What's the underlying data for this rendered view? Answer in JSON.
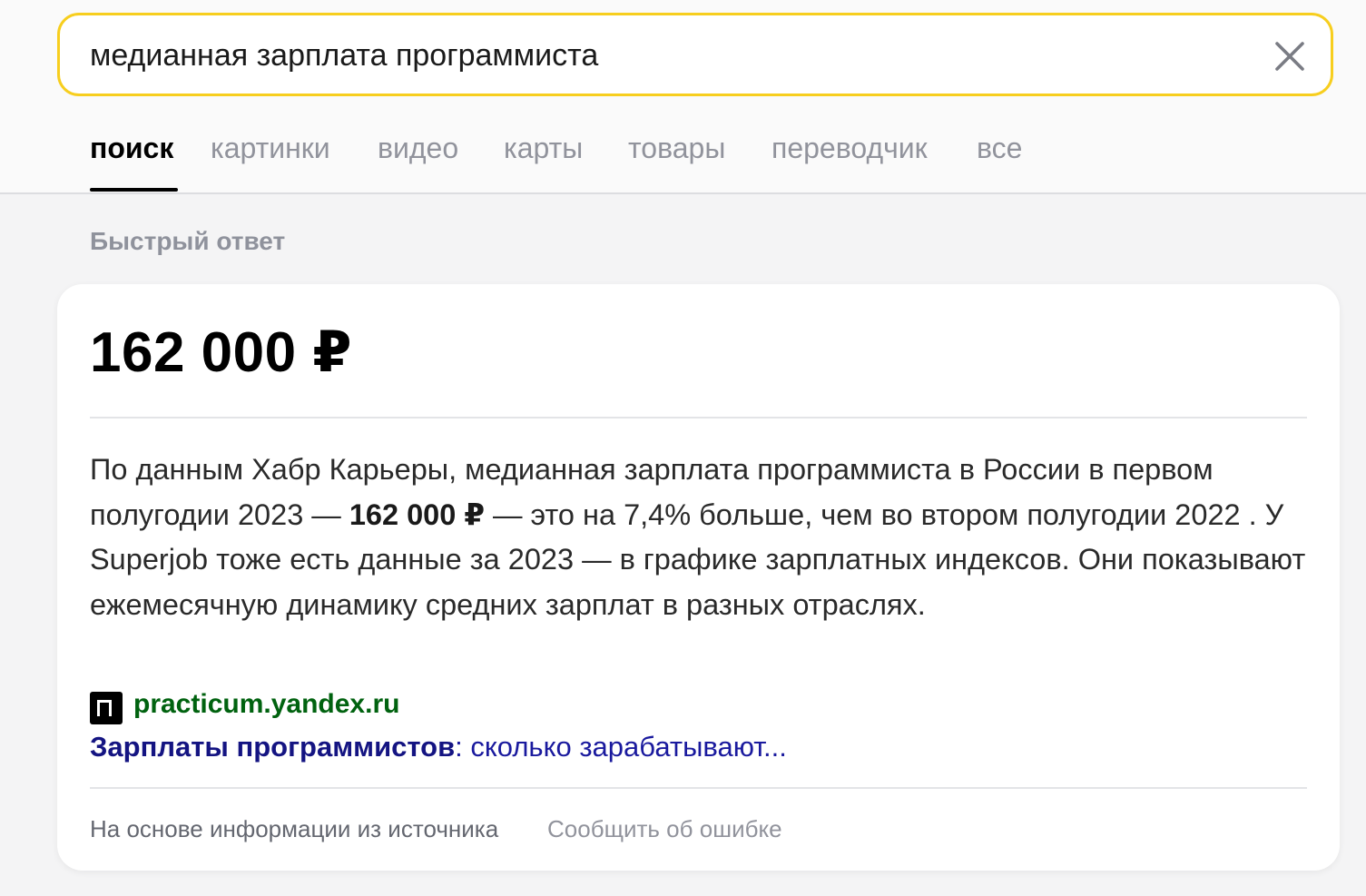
{
  "search": {
    "query": "медианная зарплата программиста"
  },
  "tabs": [
    {
      "label": "поиск",
      "active": true
    },
    {
      "label": "картинки"
    },
    {
      "label": "видео"
    },
    {
      "label": "карты"
    },
    {
      "label": "товары"
    },
    {
      "label": "переводчик"
    },
    {
      "label": "все"
    }
  ],
  "quick_answer": {
    "section_label": "Быстрый ответ",
    "value": "162 000 ₽",
    "text_parts": {
      "before": "По данным Хабр Карьеры, медианная зарплата программиста в России в первом полугодии 2023 — ",
      "highlight": "162 000 ₽",
      "after": " — это на 7,4% больше, чем во втором полугодии 2022 . У Superjob тоже есть данные за 2023 — в графике зарплатных индексов. Они показывают ежемесячную динамику средних зарплат в разных отраслях."
    },
    "source": {
      "domain": "practicum.yandex.ru",
      "title_bold": "Зарплаты программистов",
      "title_rest": ": сколько зарабатывают..."
    },
    "footer": {
      "basis": "На основе информации из источника",
      "report": "Сообщить об ошибке"
    }
  },
  "colors": {
    "search_border": "#f7ce1e",
    "source_domain": "#00620f",
    "source_title": "#1a1a9e"
  }
}
